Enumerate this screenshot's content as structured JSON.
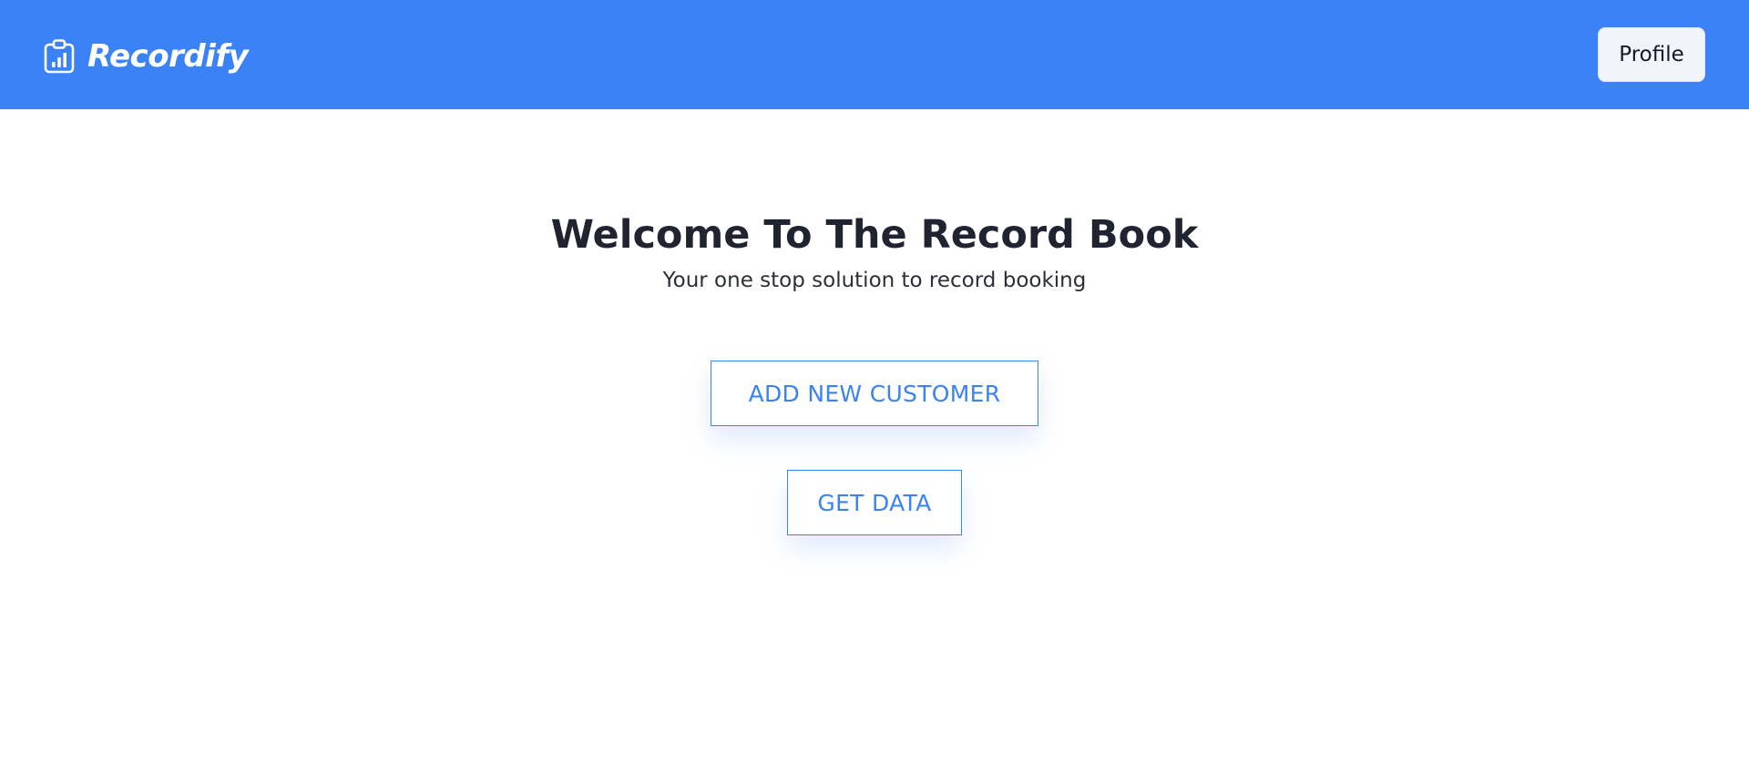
{
  "header": {
    "brand_icon": "clipboard-chart-icon",
    "brand_name": "Recordify",
    "profile_label": "Profile",
    "background_color": "#3b82f6"
  },
  "hero": {
    "title": "Welcome To The Record Book",
    "subtitle": "Your one stop solution to record booking"
  },
  "actions": {
    "add_customer_label": "ADD NEW CUSTOMER",
    "get_data_label": "GET DATA",
    "accent_color": "#3b82f6"
  }
}
